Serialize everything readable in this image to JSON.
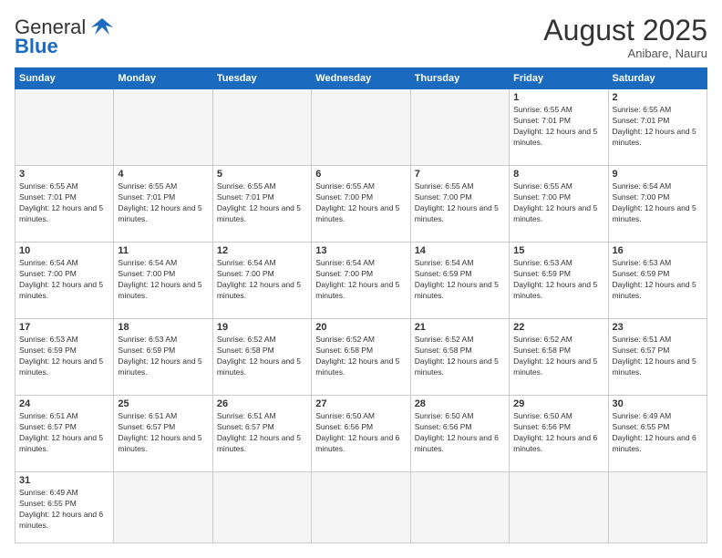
{
  "header": {
    "logo_general": "General",
    "logo_blue": "Blue",
    "month_title": "August 2025",
    "location": "Anibare, Nauru"
  },
  "days_of_week": [
    "Sunday",
    "Monday",
    "Tuesday",
    "Wednesday",
    "Thursday",
    "Friday",
    "Saturday"
  ],
  "weeks": [
    [
      {
        "day": "",
        "info": ""
      },
      {
        "day": "",
        "info": ""
      },
      {
        "day": "",
        "info": ""
      },
      {
        "day": "",
        "info": ""
      },
      {
        "day": "",
        "info": ""
      },
      {
        "day": "1",
        "info": "Sunrise: 6:55 AM\nSunset: 7:01 PM\nDaylight: 12 hours and 5 minutes."
      },
      {
        "day": "2",
        "info": "Sunrise: 6:55 AM\nSunset: 7:01 PM\nDaylight: 12 hours and 5 minutes."
      }
    ],
    [
      {
        "day": "3",
        "info": "Sunrise: 6:55 AM\nSunset: 7:01 PM\nDaylight: 12 hours and 5 minutes."
      },
      {
        "day": "4",
        "info": "Sunrise: 6:55 AM\nSunset: 7:01 PM\nDaylight: 12 hours and 5 minutes."
      },
      {
        "day": "5",
        "info": "Sunrise: 6:55 AM\nSunset: 7:01 PM\nDaylight: 12 hours and 5 minutes."
      },
      {
        "day": "6",
        "info": "Sunrise: 6:55 AM\nSunset: 7:00 PM\nDaylight: 12 hours and 5 minutes."
      },
      {
        "day": "7",
        "info": "Sunrise: 6:55 AM\nSunset: 7:00 PM\nDaylight: 12 hours and 5 minutes."
      },
      {
        "day": "8",
        "info": "Sunrise: 6:55 AM\nSunset: 7:00 PM\nDaylight: 12 hours and 5 minutes."
      },
      {
        "day": "9",
        "info": "Sunrise: 6:54 AM\nSunset: 7:00 PM\nDaylight: 12 hours and 5 minutes."
      }
    ],
    [
      {
        "day": "10",
        "info": "Sunrise: 6:54 AM\nSunset: 7:00 PM\nDaylight: 12 hours and 5 minutes."
      },
      {
        "day": "11",
        "info": "Sunrise: 6:54 AM\nSunset: 7:00 PM\nDaylight: 12 hours and 5 minutes."
      },
      {
        "day": "12",
        "info": "Sunrise: 6:54 AM\nSunset: 7:00 PM\nDaylight: 12 hours and 5 minutes."
      },
      {
        "day": "13",
        "info": "Sunrise: 6:54 AM\nSunset: 7:00 PM\nDaylight: 12 hours and 5 minutes."
      },
      {
        "day": "14",
        "info": "Sunrise: 6:54 AM\nSunset: 6:59 PM\nDaylight: 12 hours and 5 minutes."
      },
      {
        "day": "15",
        "info": "Sunrise: 6:53 AM\nSunset: 6:59 PM\nDaylight: 12 hours and 5 minutes."
      },
      {
        "day": "16",
        "info": "Sunrise: 6:53 AM\nSunset: 6:59 PM\nDaylight: 12 hours and 5 minutes."
      }
    ],
    [
      {
        "day": "17",
        "info": "Sunrise: 6:53 AM\nSunset: 6:59 PM\nDaylight: 12 hours and 5 minutes."
      },
      {
        "day": "18",
        "info": "Sunrise: 6:53 AM\nSunset: 6:59 PM\nDaylight: 12 hours and 5 minutes."
      },
      {
        "day": "19",
        "info": "Sunrise: 6:52 AM\nSunset: 6:58 PM\nDaylight: 12 hours and 5 minutes."
      },
      {
        "day": "20",
        "info": "Sunrise: 6:52 AM\nSunset: 6:58 PM\nDaylight: 12 hours and 5 minutes."
      },
      {
        "day": "21",
        "info": "Sunrise: 6:52 AM\nSunset: 6:58 PM\nDaylight: 12 hours and 5 minutes."
      },
      {
        "day": "22",
        "info": "Sunrise: 6:52 AM\nSunset: 6:58 PM\nDaylight: 12 hours and 5 minutes."
      },
      {
        "day": "23",
        "info": "Sunrise: 6:51 AM\nSunset: 6:57 PM\nDaylight: 12 hours and 5 minutes."
      }
    ],
    [
      {
        "day": "24",
        "info": "Sunrise: 6:51 AM\nSunset: 6:57 PM\nDaylight: 12 hours and 5 minutes."
      },
      {
        "day": "25",
        "info": "Sunrise: 6:51 AM\nSunset: 6:57 PM\nDaylight: 12 hours and 5 minutes."
      },
      {
        "day": "26",
        "info": "Sunrise: 6:51 AM\nSunset: 6:57 PM\nDaylight: 12 hours and 5 minutes."
      },
      {
        "day": "27",
        "info": "Sunrise: 6:50 AM\nSunset: 6:56 PM\nDaylight: 12 hours and 6 minutes."
      },
      {
        "day": "28",
        "info": "Sunrise: 6:50 AM\nSunset: 6:56 PM\nDaylight: 12 hours and 6 minutes."
      },
      {
        "day": "29",
        "info": "Sunrise: 6:50 AM\nSunset: 6:56 PM\nDaylight: 12 hours and 6 minutes."
      },
      {
        "day": "30",
        "info": "Sunrise: 6:49 AM\nSunset: 6:55 PM\nDaylight: 12 hours and 6 minutes."
      }
    ],
    [
      {
        "day": "31",
        "info": "Sunrise: 6:49 AM\nSunset: 6:55 PM\nDaylight: 12 hours and 6 minutes."
      },
      {
        "day": "",
        "info": ""
      },
      {
        "day": "",
        "info": ""
      },
      {
        "day": "",
        "info": ""
      },
      {
        "day": "",
        "info": ""
      },
      {
        "day": "",
        "info": ""
      },
      {
        "day": "",
        "info": ""
      }
    ]
  ]
}
